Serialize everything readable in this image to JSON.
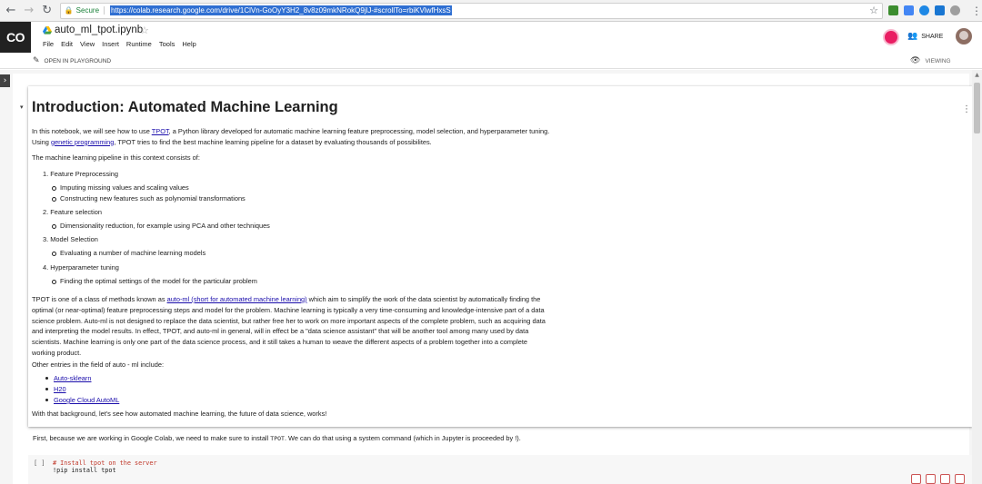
{
  "browser": {
    "secure_label": "Secure",
    "url": "https://colab.research.google.com/drive/1ClVn-GoOyY3H2_8v8z09mkNRokQ9jlJ-#scrollTo=rbiKVlwfHxsS",
    "extension_colors": [
      "#3c8d2f",
      "#4285f4",
      "#1e88e5",
      "#1976d2",
      "#9e9e9e",
      "#616161"
    ]
  },
  "colab": {
    "logo": "CO",
    "notebook_title": "auto_ml_tpot.ipynb",
    "menu": [
      "File",
      "Edit",
      "View",
      "Insert",
      "Runtime",
      "Tools",
      "Help"
    ],
    "share_label": "SHARE",
    "open_in_playground": "OPEN IN PLAYGROUND",
    "viewing_label": "VIEWING"
  },
  "text_cell": {
    "heading": "Introduction: Automated Machine Learning",
    "intro": {
      "part1": "In this notebook, we will see how to use ",
      "link1": "TPOT",
      "part2": ", a Python library developed for automatic machine learning feature preprocessing, model selection, and hyperparameter tuning. Using ",
      "link2": "genetic programming",
      "part3": ", TPOT tries to find the best machine learning pipeline for a dataset by evaluating thousands of possibilites."
    },
    "pipeline_intro": "The machine learning pipeline in this context consists of:",
    "steps": [
      {
        "num": "1.",
        "label": "Feature Preprocessing",
        "items": [
          "Imputing missing values and scaling values",
          "Constructing new features such as polynomial transformations"
        ]
      },
      {
        "num": "2.",
        "label": "Feature selection",
        "items": [
          "Dimensionality reduction, for example using PCA and other techniques"
        ]
      },
      {
        "num": "3.",
        "label": "Model Selection",
        "items": [
          "Evaluating a number of machine learning models"
        ]
      },
      {
        "num": "4.",
        "label": "Hyperparameter tuning",
        "items": [
          "Finding the optimal settings of the model for the particular problem"
        ]
      }
    ],
    "automl_para": {
      "part1": "TPOT is one of a class of methods known as ",
      "link": "auto-ml (short for automated machine learning)",
      "part2": " which aim to simplify the work of the data scientist by automatically finding the optimal (or near-optimal) feature preprocessing steps and model for the problem. Machine learning is typically a very time-consuming and knowledge-intensive part of a data science problem. Auto-ml is not designed to replace the data scientist, but rather free her to work on more important aspects of the complete problem, such as acquiring data and interpreting the model results. In effect, TPOT, and auto-ml in general, will in effect be a \"data science assistant\" that will be another tool among many used by data scientists. Machine learning is only one part of the data science process, and it still takes a human to weave the different aspects of a problem together into a complete working product."
    },
    "other_entries": "Other entries in the field of auto - ml include:",
    "links": [
      "Auto-sklearn",
      "H20",
      "Google Cloud AutoML"
    ],
    "closing": "With that background, let's see how automated machine learning, the future of data science, works!"
  },
  "install_text": {
    "part1": "First, because we are working in Google Colab, we need to make sure to install ",
    "code": "TPOT",
    "part2": ". We can do that using a system command (which in Jupyter is proceeded by !)."
  },
  "code_cell": {
    "bracket": "[ ]",
    "comment": "# Install tpot on the server",
    "command": "!pip install tpot"
  }
}
